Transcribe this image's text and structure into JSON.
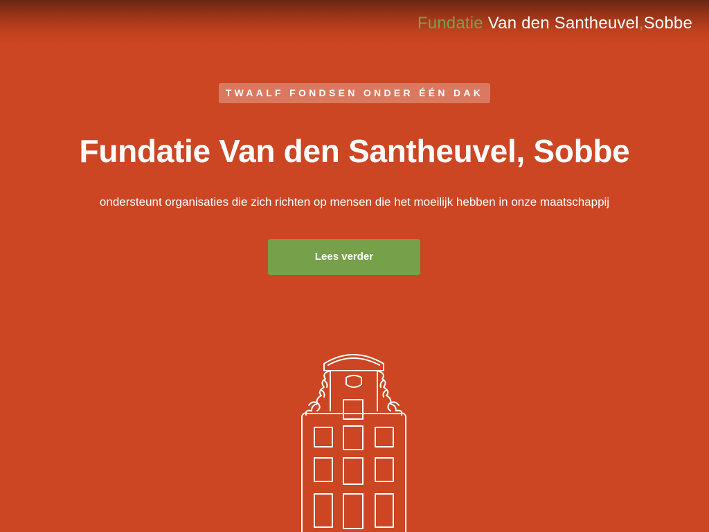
{
  "header": {
    "logo_part1": "Fundatie",
    "logo_part2": "Van den Santheuvel",
    "logo_part3": ",",
    "logo_part4": "Sobbe",
    "logo_green": "#7ba14a"
  },
  "hero": {
    "eyebrow": "TWAALF FONDSEN ONDER ÉÉN DAK",
    "title": "Fundatie Van den Santheuvel, Sobbe",
    "subtitle": "ondersteunt organisaties die zich richten op mensen die het moeilijk hebben in onze maatschappij",
    "cta_label": "Lees verder",
    "cta_color": "#76a04a",
    "illustration_icon": "canal-house-icon"
  },
  "colors": {
    "background": "#cc4623",
    "text": "#ffffff"
  }
}
